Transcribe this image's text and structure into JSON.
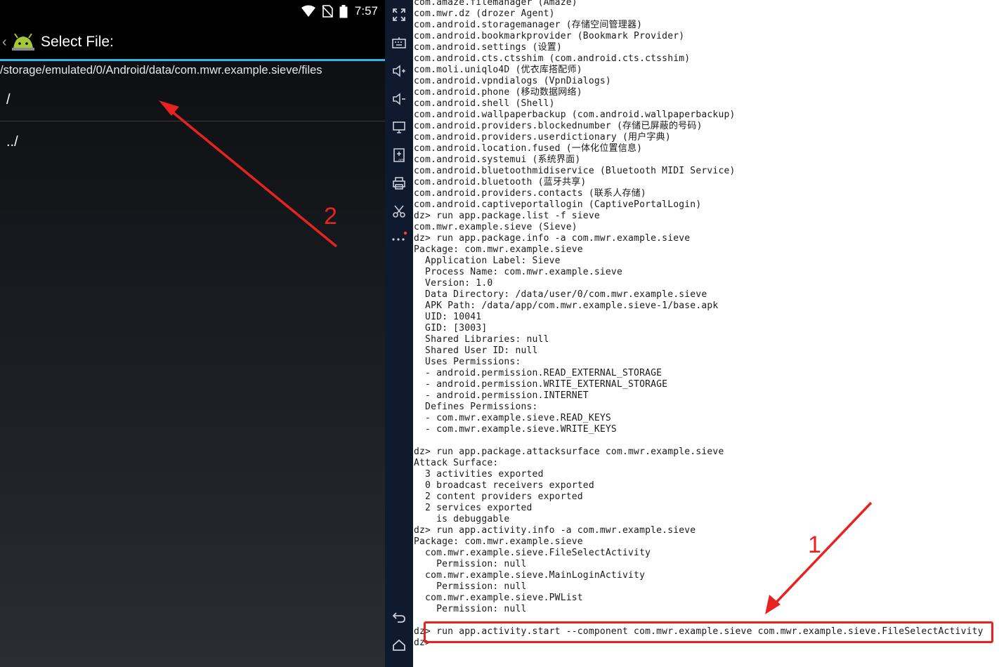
{
  "phone": {
    "status_time": "7:57",
    "title": "Select File:",
    "path": "/storage/emulated/0/Android/data/com.mwr.example.sieve/files",
    "entries": [
      "/",
      "../"
    ]
  },
  "toolbar": {
    "buttons": [
      "fullscreen-icon",
      "keyboard-icon",
      "volume-up-icon",
      "volume-down-icon",
      "screen-icon",
      "install-apk-icon",
      "print-icon",
      "scissors-icon",
      "more-icon",
      "back-icon",
      "home-icon"
    ]
  },
  "terminal": {
    "lines": [
      "com.amaze.filemanager (Amaze)",
      "com.mwr.dz (drozer Agent)",
      "com.android.storagemanager (存储空间管理器)",
      "com.android.bookmarkprovider (Bookmark Provider)",
      "com.android.settings (设置)",
      "com.android.cts.ctsshim (com.android.cts.ctsshim)",
      "com.moli.uniqlo4D (优衣库搭配师)",
      "com.android.vpndialogs (VpnDialogs)",
      "com.android.phone (移动数据网络)",
      "com.android.shell (Shell)",
      "com.android.wallpaperbackup (com.android.wallpaperbackup)",
      "com.android.providers.blockednumber (存储已屏蔽的号码)",
      "com.android.providers.userdictionary (用户字典)",
      "com.android.location.fused (一体化位置信息)",
      "com.android.systemui (系统界面)",
      "com.android.bluetoothmidiservice (Bluetooth MIDI Service)",
      "com.android.bluetooth (蓝牙共享)",
      "com.android.providers.contacts (联系人存储)",
      "com.android.captiveportallogin (CaptivePortalLogin)",
      "dz> run app.package.list -f sieve",
      "com.mwr.example.sieve (Sieve)",
      "dz> run app.package.info -a com.mwr.example.sieve",
      "Package: com.mwr.example.sieve",
      "  Application Label: Sieve",
      "  Process Name: com.mwr.example.sieve",
      "  Version: 1.0",
      "  Data Directory: /data/user/0/com.mwr.example.sieve",
      "  APK Path: /data/app/com.mwr.example.sieve-1/base.apk",
      "  UID: 10041",
      "  GID: [3003]",
      "  Shared Libraries: null",
      "  Shared User ID: null",
      "  Uses Permissions:",
      "  - android.permission.READ_EXTERNAL_STORAGE",
      "  - android.permission.WRITE_EXTERNAL_STORAGE",
      "  - android.permission.INTERNET",
      "  Defines Permissions:",
      "  - com.mwr.example.sieve.READ_KEYS",
      "  - com.mwr.example.sieve.WRITE_KEYS",
      "",
      "dz> run app.package.attacksurface com.mwr.example.sieve",
      "Attack Surface:",
      "  3 activities exported",
      "  0 broadcast receivers exported",
      "  2 content providers exported",
      "  2 services exported",
      "    is debuggable",
      "dz> run app.activity.info -a com.mwr.example.sieve",
      "Package: com.mwr.example.sieve",
      "  com.mwr.example.sieve.FileSelectActivity",
      "    Permission: null",
      "  com.mwr.example.sieve.MainLoginActivity",
      "    Permission: null",
      "  com.mwr.example.sieve.PWList",
      "    Permission: null",
      "",
      "dz> run app.activity.start --component com.mwr.example.sieve com.mwr.example.sieve.FileSelectActivity",
      "dz>"
    ]
  },
  "annotations": {
    "label_1": "1",
    "label_2": "2",
    "color": "#e8231f"
  }
}
